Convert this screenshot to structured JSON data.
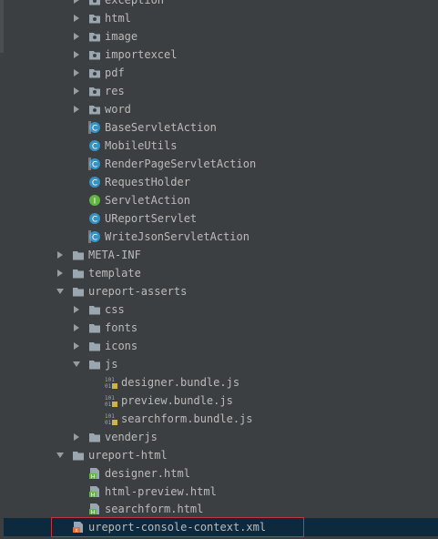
{
  "project_tree": {
    "items": [
      {
        "label": "exception",
        "type": "package",
        "state": "collapsed"
      },
      {
        "label": "html",
        "type": "package",
        "state": "collapsed"
      },
      {
        "label": "image",
        "type": "package",
        "state": "collapsed"
      },
      {
        "label": "importexcel",
        "type": "package",
        "state": "collapsed"
      },
      {
        "label": "pdf",
        "type": "package",
        "state": "collapsed"
      },
      {
        "label": "res",
        "type": "package",
        "state": "collapsed"
      },
      {
        "label": "word",
        "type": "package",
        "state": "collapsed"
      },
      {
        "label": "BaseServletAction",
        "type": "abstract-class"
      },
      {
        "label": "MobileUtils",
        "type": "class"
      },
      {
        "label": "RenderPageServletAction",
        "type": "abstract-class"
      },
      {
        "label": "RequestHolder",
        "type": "class"
      },
      {
        "label": "ServletAction",
        "type": "interface"
      },
      {
        "label": "UReportServlet",
        "type": "class"
      },
      {
        "label": "WriteJsonServletAction",
        "type": "abstract-class"
      },
      {
        "label": "META-INF",
        "type": "folder",
        "state": "collapsed"
      },
      {
        "label": "template",
        "type": "folder",
        "state": "collapsed"
      },
      {
        "label": "ureport-asserts",
        "type": "folder",
        "state": "expanded"
      },
      {
        "label": "css",
        "type": "folder",
        "state": "collapsed"
      },
      {
        "label": "fonts",
        "type": "folder",
        "state": "collapsed"
      },
      {
        "label": "icons",
        "type": "folder",
        "state": "collapsed"
      },
      {
        "label": "js",
        "type": "folder",
        "state": "expanded"
      },
      {
        "label": "designer.bundle.js",
        "type": "js-file"
      },
      {
        "label": "preview.bundle.js",
        "type": "js-file"
      },
      {
        "label": "searchform.bundle.js",
        "type": "js-file"
      },
      {
        "label": "venderjs",
        "type": "folder",
        "state": "collapsed"
      },
      {
        "label": "ureport-html",
        "type": "folder",
        "state": "expanded"
      },
      {
        "label": "designer.html",
        "type": "html-file"
      },
      {
        "label": "html-preview.html",
        "type": "html-file"
      },
      {
        "label": "searchform.html",
        "type": "html-file"
      },
      {
        "label": "ureport-console-context.xml",
        "type": "xml-file",
        "selected": true
      }
    ]
  },
  "colors": {
    "background": "#3c3f41",
    "text": "#bbbbbb",
    "selection": "#0d293e",
    "highlight_box": "#c1363f",
    "class_icon": "#3592c4",
    "interface_icon": "#62b543",
    "folder_icon": "#9aa7b0"
  }
}
